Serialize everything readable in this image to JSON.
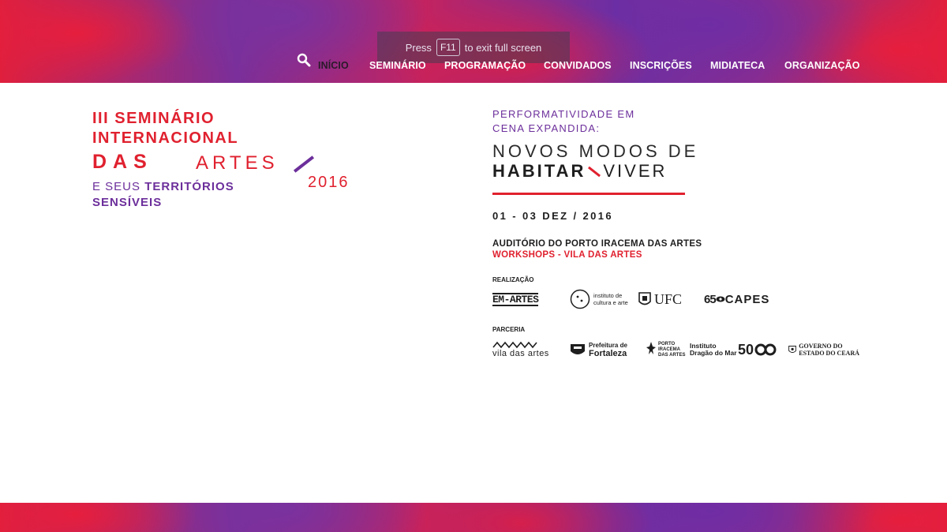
{
  "fullscreen_notice": {
    "prefix": "Press",
    "key": "F11",
    "suffix": "to exit full screen"
  },
  "nav": {
    "items": [
      "INÍCIO",
      "SEMINÁRIO",
      "PROGRAMAÇÃO",
      "CONVIDADOS",
      "INSCRIÇÕES",
      "MIDIATECA",
      "ORGANIZAÇÃO"
    ],
    "active": "INÍCIO",
    "search_icon": "search-icon"
  },
  "left_title": {
    "line1": "III SEMINÁRIO",
    "line2": "INTERNACIONAL",
    "das": "DAS",
    "artes": "ARTES",
    "year": "2016",
    "line4_prefix": "E SEUS",
    "line4_bold": "TERRITÓRIOS",
    "line5": "SENSÍVEIS"
  },
  "right_block": {
    "perf_line1": "PERFORMATIVIDADE EM",
    "perf_line2": "CENA EXPANDIDA:",
    "novos": "NOVOS MODOS DE",
    "habitar": "HABITAR",
    "viver": "VIVER",
    "date": "01 - 03 DEZ / 2016",
    "venue": "AUDITÓRIO DO PORTO IRACEMA DAS ARTES",
    "workshops": "WORKSHOPS - VILA DAS ARTES",
    "realizacao_label": "REALIZAÇÃO",
    "parceria_label": "PARCERIA"
  },
  "logos_realizacao": {
    "emartes": "EM-ARTES",
    "instituto": "instituto de cultura e arte",
    "ufc": "UFC",
    "capes_num": "65",
    "capes": "CAPES"
  },
  "logos_parceria": {
    "vila": "vila das artes",
    "prefeitura_1": "Prefeitura de",
    "prefeitura_2": "Fortaleza",
    "porto_1": "PORTO",
    "porto_2": "IRACEMA",
    "porto_3": "DAS ARTES",
    "dragao_1": "Instituto",
    "dragao_2": "Dragão do Mar",
    "cinquenta": "50",
    "governo_1": "GOVERNO DO",
    "governo_2": "ESTADO DO CEARÁ"
  },
  "colors": {
    "red": "#e0212f",
    "purple": "#6c2f9b",
    "dark": "#1e1e1e"
  }
}
